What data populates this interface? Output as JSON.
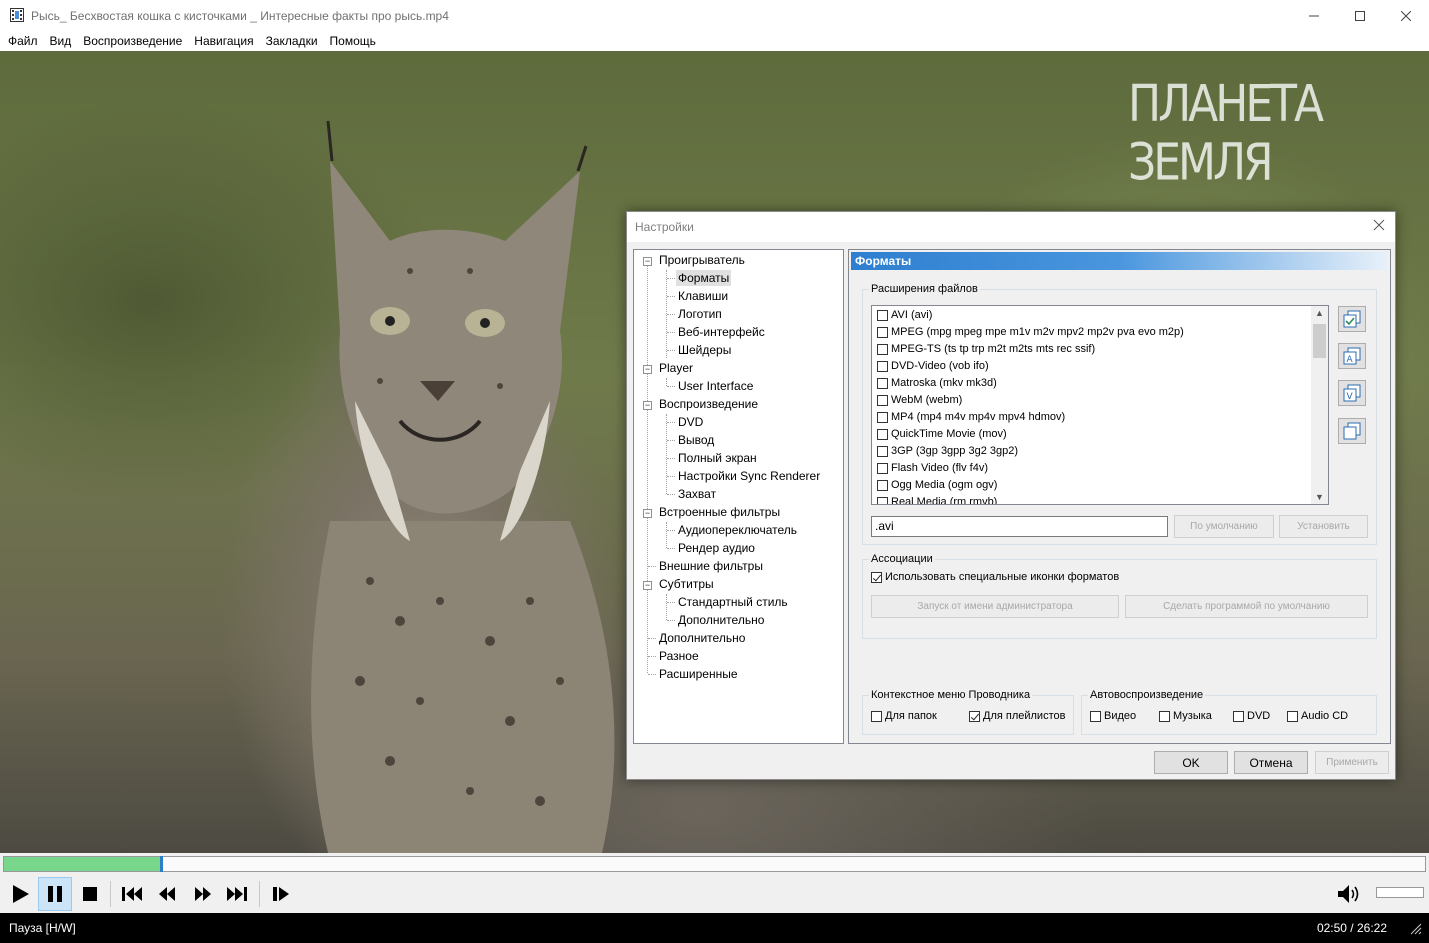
{
  "window": {
    "title": "Рысь_ Бесхвостая кошка с кисточками _ Интересные факты про рысь.mp4"
  },
  "menu": [
    "Файл",
    "Вид",
    "Воспроизведение",
    "Навигация",
    "Закладки",
    "Помощь"
  ],
  "video": {
    "watermark": "ПЛАНЕТА ЗЕМЛЯ"
  },
  "playback": {
    "progress": 0.11
  },
  "volume": {
    "level": 1.0
  },
  "status": {
    "state": "Пауза [H/W]",
    "time": "02:50 / 26:22"
  },
  "dialog": {
    "title": "Настройки",
    "tree": [
      {
        "label": "Проигрыватель",
        "level": 0,
        "toggle": "-"
      },
      {
        "label": "Форматы",
        "level": 1,
        "selected": true
      },
      {
        "label": "Клавиши",
        "level": 1
      },
      {
        "label": "Логотип",
        "level": 1
      },
      {
        "label": "Веб-интерфейс",
        "level": 1
      },
      {
        "label": "Шейдеры",
        "level": 1
      },
      {
        "label": "Player",
        "level": 0,
        "toggle": "-"
      },
      {
        "label": "User Interface",
        "level": 1
      },
      {
        "label": "Воспроизведение",
        "level": 0,
        "toggle": "-"
      },
      {
        "label": "DVD",
        "level": 1
      },
      {
        "label": "Вывод",
        "level": 1
      },
      {
        "label": "Полный экран",
        "level": 1
      },
      {
        "label": "Настройки Sync Renderer",
        "level": 1
      },
      {
        "label": "Захват",
        "level": 1
      },
      {
        "label": "Встроенные фильтры",
        "level": 0,
        "toggle": "-"
      },
      {
        "label": "Аудиопереключатель",
        "level": 1
      },
      {
        "label": "Рендер аудио",
        "level": 1
      },
      {
        "label": "Внешние фильтры",
        "level": 0
      },
      {
        "label": "Субтитры",
        "level": 0,
        "toggle": "-"
      },
      {
        "label": "Стандартный стиль",
        "level": 1
      },
      {
        "label": "Дополнительно",
        "level": 1
      },
      {
        "label": "Дополнительно",
        "level": 0
      },
      {
        "label": "Разное",
        "level": 0
      },
      {
        "label": "Расширенные",
        "level": 0
      }
    ],
    "panel": {
      "header": "Форматы",
      "extensions_group": "Расширения файлов",
      "extensions": [
        "AVI (avi)",
        "MPEG (mpg mpeg mpe m1v m2v mpv2 mp2v pva evo m2p)",
        "MPEG-TS (ts tp trp m2t m2ts mts rec ssif)",
        "DVD-Video (vob ifo)",
        "Matroska (mkv mk3d)",
        "WebM (webm)",
        "MP4 (mp4 m4v mp4v mpv4 hdmov)",
        "QuickTime Movie (mov)",
        "3GP (3gp 3gpp 3g2 3gp2)",
        "Flash Video (flv f4v)",
        "Ogg Media (ogm ogv)",
        "Real Media (rm rmvb)"
      ],
      "ext_value": ".avi",
      "default_button": "По умолчанию",
      "set_button": "Установить",
      "assoc_group": "Ассоциации",
      "use_icons": "Использовать специальные иконки форматов",
      "run_admin_button": "Запуск от имени администратора",
      "set_default_programs_button": "Сделать программой по умолчанию",
      "explorer_group": "Контекстное меню Проводника",
      "for_folders": "Для папок",
      "for_playlists": "Для плейлистов",
      "autoplay_group": "Автовоспроизведение",
      "autoplay": [
        "Видео",
        "Музыка",
        "DVD",
        "Audio CD"
      ]
    },
    "ok": "OK",
    "cancel": "Отмена",
    "apply": "Применить"
  }
}
